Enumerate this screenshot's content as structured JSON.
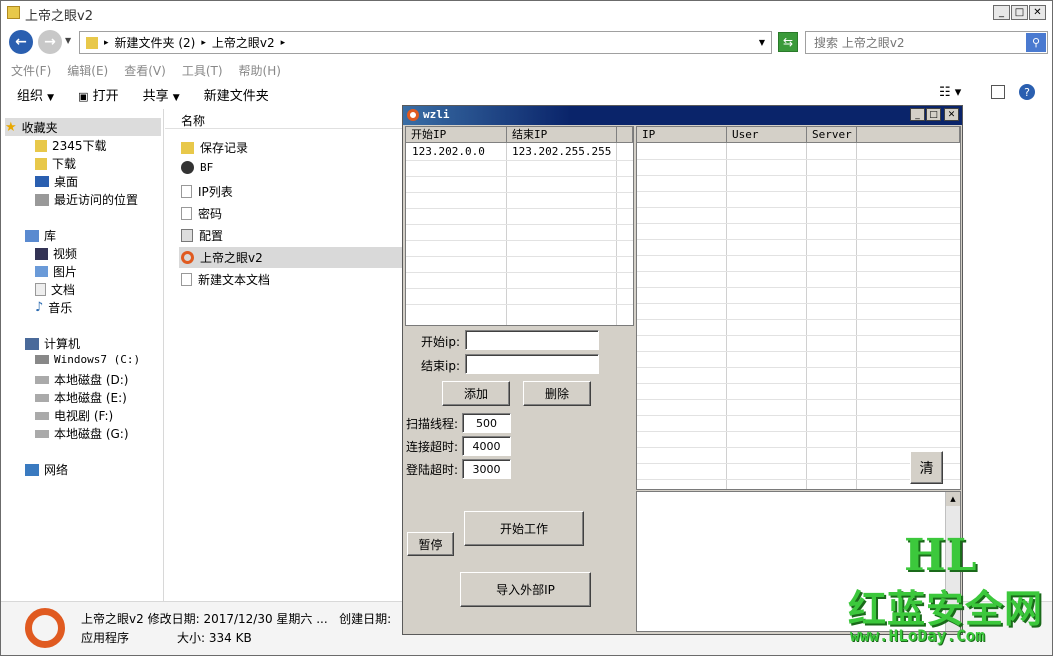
{
  "explorer": {
    "title": "上帝之眼v2",
    "breadcrumb": [
      "新建文件夹 (2)",
      "上帝之眼v2"
    ],
    "search_placeholder": "搜索 上帝之眼v2",
    "menu": [
      "文件(F)",
      "编辑(E)",
      "查看(V)",
      "工具(T)",
      "帮助(H)"
    ],
    "toolbar": {
      "organize": "组织",
      "open": "打开",
      "share": "共享",
      "new_folder": "新建文件夹"
    },
    "sidebar": {
      "favorites": "收藏夹",
      "fav_items": [
        "2345下载",
        "下载",
        "桌面",
        "最近访问的位置"
      ],
      "libraries": "库",
      "lib_items": [
        "视频",
        "图片",
        "文档",
        "音乐"
      ],
      "computer": "计算机",
      "drives": [
        "Windows7 (C:)",
        "本地磁盘 (D:)",
        "本地磁盘 (E:)",
        "电视剧 (F:)",
        "本地磁盘 (G:)"
      ],
      "network": "网络"
    },
    "column_name": "名称",
    "files": [
      "保存记录",
      "BF",
      "IP列表",
      "密码",
      "配置",
      "上帝之眼v2",
      "新建文本文档"
    ],
    "status": {
      "name": "上帝之眼v2",
      "modified_label": "修改日期:",
      "modified_value": "2017/12/30 星期六 ...",
      "created_label": "创建日期:",
      "type": "应用程序",
      "size_label": "大小:",
      "size_value": "334 KB"
    }
  },
  "app": {
    "title": "wzli",
    "range_cols": [
      "开始IP",
      "结束IP"
    ],
    "range_rows": [
      [
        "123.202.0.0",
        "123.202.255.255"
      ]
    ],
    "result_cols": [
      "IP",
      "User",
      "Server"
    ],
    "start_ip_label": "开始ip:",
    "end_ip_label": "结束ip:",
    "start_ip_value": "",
    "end_ip_value": "",
    "add_button": "添加",
    "delete_button": "删除",
    "threads_label": "扫描线程:",
    "threads_value": "500",
    "connect_timeout_label": "连接超时:",
    "connect_timeout_value": "4000",
    "login_timeout_label": "登陆超时:",
    "login_timeout_value": "3000",
    "clear_button": "清",
    "pause_button": "暂停",
    "start_button": "开始工作",
    "import_button": "导入外部IP"
  },
  "watermark": {
    "line1": "HL",
    "line2": "红蓝安全网",
    "line3": "www.HLoDay.Com"
  },
  "colors": {
    "accent_blue": "#0a246a",
    "watermark_green": "#3cc83c",
    "folder_yellow": "#e8c84a"
  }
}
